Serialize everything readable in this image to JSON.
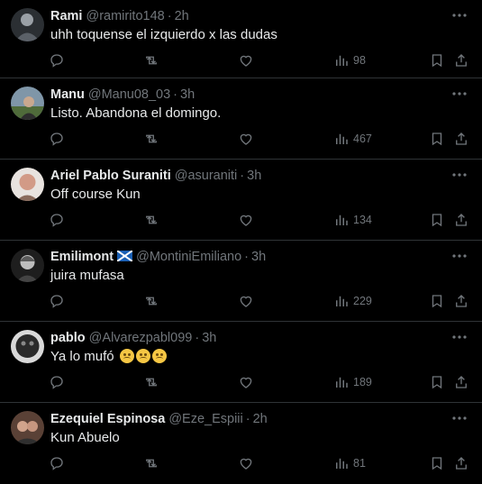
{
  "tweets": [
    {
      "name": "Rami",
      "handle": "@ramirito148",
      "time": "2h",
      "text": "uhh toquense el izquierdo x las dudas",
      "views": "98",
      "avatar_color": "#3a3f44"
    },
    {
      "name": "Manu",
      "handle": "@Manu08_03",
      "time": "3h",
      "text": "Listo. Abandona el domingo.",
      "views": "467",
      "avatar_color": "#6b7f8e"
    },
    {
      "name": "Ariel Pablo Suraniti",
      "handle": "@asuraniti",
      "time": "3h",
      "text": "Off course Kun",
      "views": "134",
      "avatar_color": "#c98d7a"
    },
    {
      "name": "Emilimont",
      "handle": "@MontiniEmiliano",
      "time": "3h",
      "text": "juira mufasa",
      "views": "229",
      "avatar_color": "#3b3b3b",
      "flag": "scotland-flag"
    },
    {
      "name": "pablo",
      "handle": "@Alvarezpabl099",
      "time": "3h",
      "text": "Ya lo mufó",
      "views": "189",
      "avatar_color": "#2e2e2e",
      "emoji_count": 3
    },
    {
      "name": "Ezequiel Espinosa",
      "handle": "@Eze_Espiii",
      "time": "2h",
      "text": "Kun Abuelo",
      "views": "81",
      "avatar_color": "#7a5a4a"
    }
  ],
  "separator": "·",
  "colors": {
    "background": "#000000",
    "text": "#e7e9ea",
    "muted": "#71767b",
    "border": "#2f3336"
  },
  "icons": {
    "reply": "reply-icon",
    "retweet": "retweet-icon",
    "like": "heart-icon",
    "views": "views-icon",
    "bookmark": "bookmark-icon",
    "share": "share-icon",
    "more": "more-icon"
  }
}
